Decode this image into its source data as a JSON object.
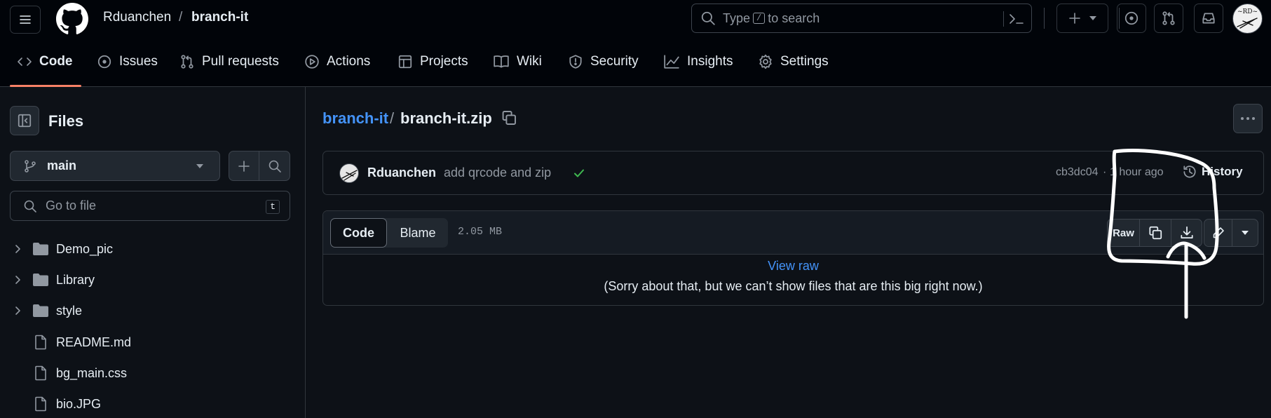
{
  "header": {
    "owner": "Rduanchen",
    "separator": "/",
    "repo": "branch-it",
    "search_prefix": "Type",
    "search_key": "/",
    "search_suffix": "to search",
    "avatar_text": "~RD~"
  },
  "nav": {
    "tabs": [
      {
        "label": "Code",
        "icon": "code-icon",
        "active": true
      },
      {
        "label": "Issues",
        "icon": "issue-icon"
      },
      {
        "label": "Pull requests",
        "icon": "pull-request-icon"
      },
      {
        "label": "Actions",
        "icon": "play-icon"
      },
      {
        "label": "Projects",
        "icon": "table-icon"
      },
      {
        "label": "Wiki",
        "icon": "book-icon"
      },
      {
        "label": "Security",
        "icon": "shield-icon"
      },
      {
        "label": "Insights",
        "icon": "graph-icon"
      },
      {
        "label": "Settings",
        "icon": "gear-icon"
      }
    ]
  },
  "sidebar": {
    "title": "Files",
    "branch": "main",
    "go_to_file_placeholder": "Go to file",
    "shortcut": "t",
    "tree": [
      {
        "name": "Demo_pic",
        "type": "folder"
      },
      {
        "name": "Library",
        "type": "folder"
      },
      {
        "name": "style",
        "type": "folder"
      },
      {
        "name": "README.md",
        "type": "file"
      },
      {
        "name": "bg_main.css",
        "type": "file"
      },
      {
        "name": "bio.JPG",
        "type": "file"
      }
    ]
  },
  "main": {
    "path_repo": "branch-it",
    "path_sep": "/",
    "path_file": "branch-it.zip",
    "commit": {
      "author": "Rduanchen",
      "message": "add qrcode and zip",
      "sha": "cb3dc04",
      "dot": "·",
      "time": "1 hour ago",
      "history_label": "History"
    },
    "file": {
      "tab_code": "Code",
      "tab_blame": "Blame",
      "size": "2.05 MB",
      "raw_label": "Raw",
      "view_raw": "View raw",
      "too_big_message": "(Sorry about that, but we can’t show files that are this big right now.)"
    }
  },
  "colors": {
    "accent_link": "#4493f8",
    "success": "#3fb950",
    "tab_underline": "#f78166",
    "annotation": "#ffffff"
  }
}
